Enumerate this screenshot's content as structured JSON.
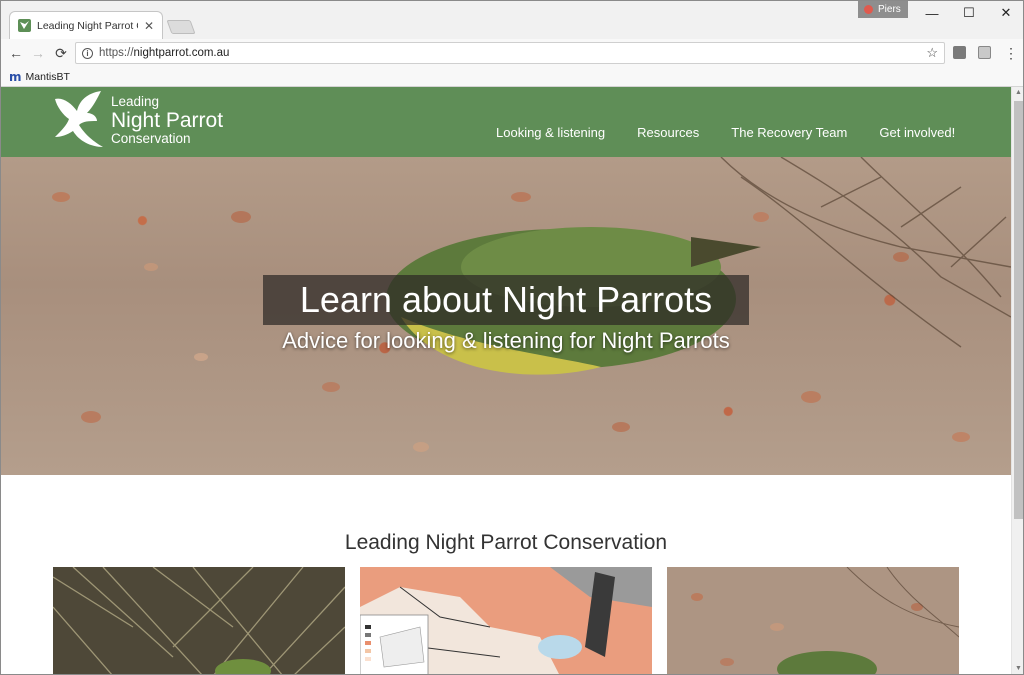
{
  "browser": {
    "tab": {
      "title": "Leading Night Parrot Con",
      "close": "✕"
    },
    "profile": "Piers",
    "controls": {
      "minimize": "—",
      "maximize": "☐",
      "close": "✕"
    },
    "nav": {
      "back": "←",
      "forward": "→",
      "reload": "⟳",
      "menu": "⋮"
    },
    "address": {
      "scheme": "https://",
      "host": "nightparrot.com.au"
    },
    "bookmarks": [
      {
        "icon": "m",
        "label": "MantisBT"
      }
    ]
  },
  "site": {
    "logo": {
      "line1": "Leading",
      "line2": "Night Parrot",
      "line3": "Conservation"
    },
    "nav": [
      {
        "label": "Looking & listening"
      },
      {
        "label": "Resources"
      },
      {
        "label": "The Recovery Team"
      },
      {
        "label": "Get involved!"
      }
    ],
    "hero": {
      "title": "Learn about Night Parrots",
      "subtitle": "Advice for looking & listening for Night Parrots"
    },
    "section_heading": "Leading Night Parrot Conservation",
    "colors": {
      "header_green": "#5f8e57",
      "hero_overlay": "#2d2826"
    }
  }
}
